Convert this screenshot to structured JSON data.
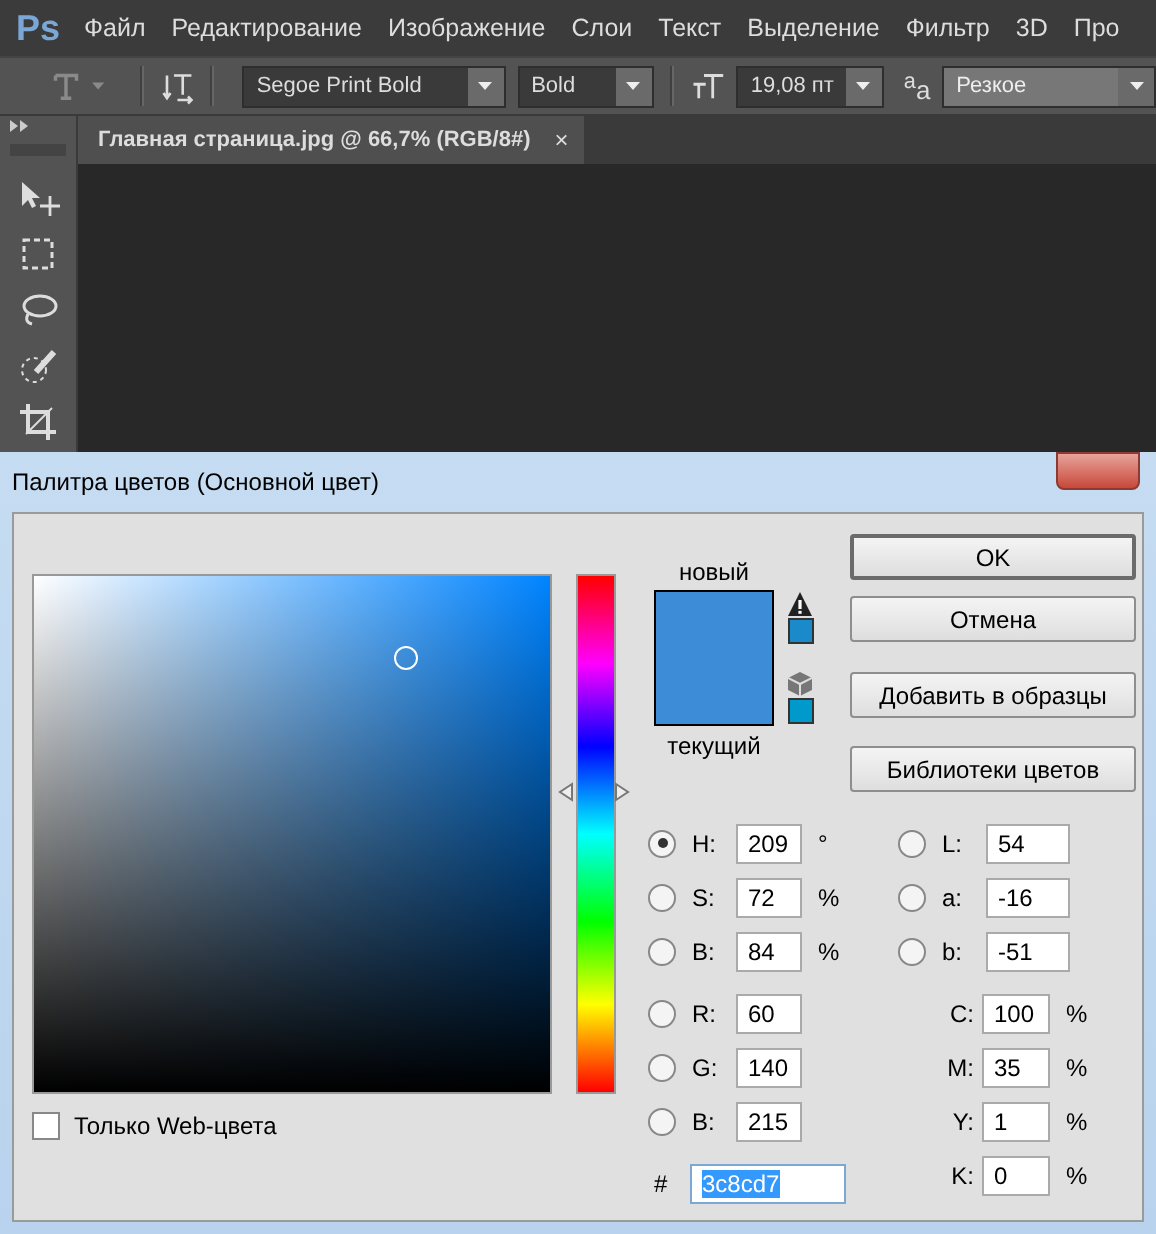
{
  "app": {
    "logo": "Ps",
    "menu": [
      "Файл",
      "Редактирование",
      "Изображение",
      "Слои",
      "Текст",
      "Выделение",
      "Фильтр",
      "3D",
      "Про"
    ]
  },
  "options_bar": {
    "font_family": "Segoe Print Bold",
    "font_style": "Bold",
    "font_size": "19,08 пт",
    "antialias_glyph": "$^{a}$a",
    "antialias": "Резкое"
  },
  "document_tab": {
    "title": "Главная страница.jpg @ 66,7% (RGB/8#)",
    "close": "×"
  },
  "dialog": {
    "title": "Палитра цветов (Основной цвет)",
    "hue_slider": {
      "level": 0.58
    },
    "new_label": "новый",
    "current_label": "текущий",
    "buttons": [
      {
        "label": "OK",
        "default": true
      },
      {
        "label": "Отмена",
        "default": false
      },
      {
        "label": "Добавить в образцы",
        "default": false
      },
      {
        "label": "Библиотеки цветов",
        "default": false
      }
    ],
    "web_only": {
      "label": "Только Web-цвета",
      "checked": false
    },
    "left_fields": [
      {
        "kind": "radio",
        "label": "H:",
        "value": "209",
        "unit": "°",
        "selected": true
      },
      {
        "kind": "radio",
        "label": "S:",
        "value": "72",
        "unit": "%",
        "selected": false
      },
      {
        "kind": "radio",
        "label": "B:",
        "value": "84",
        "unit": "%",
        "selected": false
      },
      {
        "kind": "radio",
        "label": "R:",
        "value": "60",
        "selected": false
      },
      {
        "kind": "radio",
        "label": "G:",
        "value": "140",
        "selected": false
      },
      {
        "kind": "radio",
        "label": "B:",
        "value": "215",
        "selected": false
      }
    ],
    "hex": {
      "label": "#",
      "value": "3c8cd7"
    },
    "right_fields": [
      {
        "kind": "radio",
        "label": "L:",
        "value": "54",
        "selected": false
      },
      {
        "kind": "radio",
        "label": "a:",
        "value": "-16",
        "selected": false
      },
      {
        "kind": "radio",
        "label": "b:",
        "value": "-51",
        "selected": false
      },
      {
        "kind": "plain",
        "label": "C:",
        "value": "100",
        "unit": "%"
      },
      {
        "kind": "plain",
        "label": "M:",
        "value": "35",
        "unit": "%"
      },
      {
        "kind": "plain",
        "label": "Y:",
        "value": "1",
        "unit": "%"
      },
      {
        "kind": "plain",
        "label": "K:",
        "value": "0",
        "unit": "%"
      }
    ]
  }
}
